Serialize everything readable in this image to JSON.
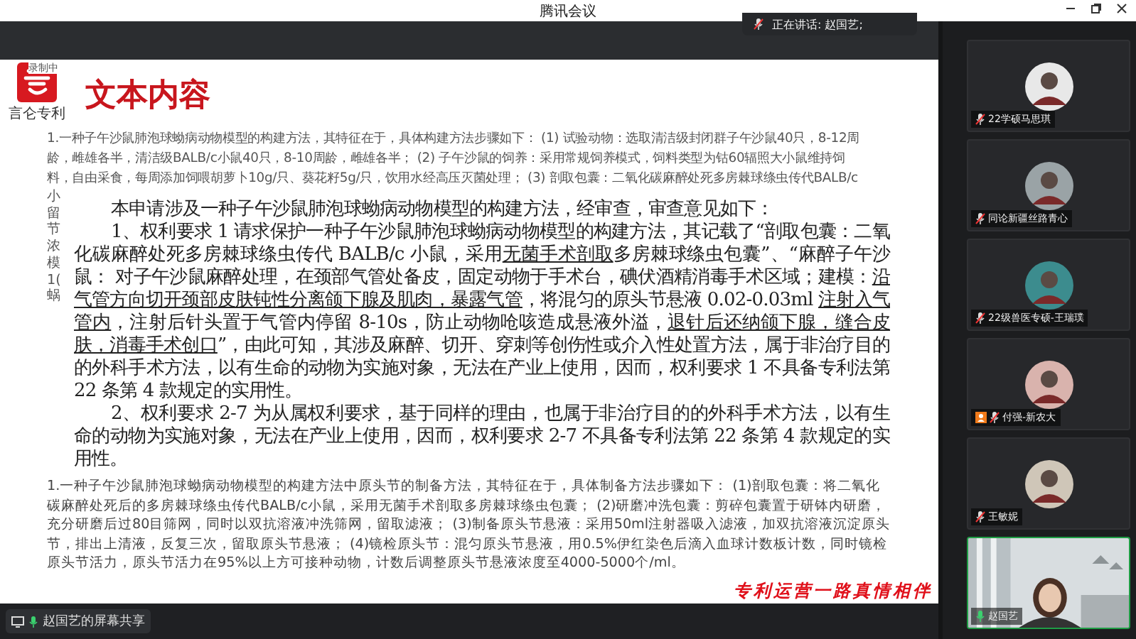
{
  "window": {
    "title": "腾讯会议"
  },
  "recording": {
    "label": "录制中"
  },
  "speaker_banner": {
    "label": "正在讲话: 赵国艺;"
  },
  "slide": {
    "brand": "言仑专利",
    "title": "文本内容",
    "paragraph_top_lines": [
      "1.一种子午沙鼠肺泡球蚴病动物模型的构建方法，其特征在于，具体构建方法步骤如下：  (1) 试验动物：选取清洁级封闭群子午沙鼠40只，8-12周",
      "龄，雌雄各半，清洁级BALB/c小鼠40只，8-10周龄，雌雄各半；  (2) 子午沙鼠的饲养：采用常规饲养模式，饲料类型为钴60辐照大小鼠维持饲",
      "料，自由采食，每周添加饲喂胡萝卜10g/只、葵花籽5g/只，饮用水经高压灭菌处理；  (3) 剖取包囊：二氧化碳麻醉处死多房棘球绦虫传代BALB/c"
    ],
    "line_starts": [
      "小",
      "留",
      "节",
      "浓",
      "模",
      "1(",
      "蜗"
    ],
    "document": {
      "heading": "本申请涉及一种子午沙鼠肺泡球蚴病动物模型的构建方法，经审查，审查意见如下：",
      "paragraphs": [
        {
          "segments": [
            {
              "text": "1、权利要求 1 请求保护一种子午沙鼠肺泡球蚴病动物模型的构建方法，其记载了“剖取包囊：二氧化碳麻醉处死多房棘球绦虫传代 BALB/c 小鼠，采用",
              "underlined": false
            },
            {
              "text": "无菌手术剖取",
              "underlined": true
            },
            {
              "text": "多房棘球绦虫包囊”、“麻醉子午沙鼠： 对子午沙鼠麻醉处理，在颈部气管处备皮，固定动物于手术台，碘伏酒精消毒手术区域；建模：",
              "underlined": false
            },
            {
              "text": "沿气管方向切开颈部皮肤钝性分离颌下腺及肌肉，暴露气管",
              "underlined": true
            },
            {
              "text": "，将混匀的原头节悬液 0.02-0.03ml ",
              "underlined": false
            },
            {
              "text": "注射入气管内",
              "underlined": true
            },
            {
              "text": "，注射后针头置于气管内停留 8-10s，防止动物呛咳造成悬液外溢，",
              "underlined": false
            },
            {
              "text": "退针后还纳颌下腺，缝合皮肤，消毒手术创口",
              "underlined": true
            },
            {
              "text": "”，由此可知，其涉及麻醉、切开、穿刺等创伤性或介入性处置方法，属于非治疗目的的外科手术方法，以有生命的动物为实施对象，无法在产业上使用，因而，权利要求 1 不具备专利法第 22 条第 4 款规定的实用性。",
              "underlined": false
            }
          ]
        },
        {
          "segments": [
            {
              "text": "2、权利要求 2-7 为从属权利要求，基于同样的理由，也属于非治疗目的的外科手术方法，以有生命的动物为实施对象，无法在产业上使用，因而，权利要求 2-7 不具备专利法第 22 条第 4 款规定的实用性。",
              "underlined": false
            }
          ]
        }
      ]
    },
    "paragraph_bottom": "1.一种子午沙鼠肺泡球蚴病动物模型的构建方法中原头节的制备方法，其特征在于，具体制备方法步骤如下： (1)剖取包囊：将二氧化碳麻醉处死后的多房棘球绦虫传代BALB/c小鼠，采用无菌手术剖取多房棘球绦虫包囊； (2)研磨冲洗包囊：剪碎包囊置于研钵内研磨，充分研磨后过80目筛网，同时以双抗溶液冲洗筛网，留取滤液； (3)制备原头节悬液：采用50ml注射器吸入滤液，加双抗溶液沉淀原头节，排出上清液，反复三次，留取原头节悬液； (4)镜检原头节：混匀原头节悬液，用0.5%伊红染色后滴入血球计数板计数，同时镜检原头节活力，原头节活力在95%以上方可接种动物，计数后调整原头节悬液浓度至4000-5000个/ml。",
    "slogan": "专利运营一路真情相伴"
  },
  "participants": [
    {
      "name": "22学硕马思琪",
      "kind": "avatar",
      "muted": true,
      "speaking": false,
      "host_badge": false
    },
    {
      "name": "同论新疆丝路青心",
      "kind": "avatar",
      "muted": true,
      "speaking": false,
      "host_badge": false
    },
    {
      "name": "22级兽医专硕-王瑞璞",
      "kind": "avatar",
      "muted": true,
      "speaking": false,
      "host_badge": false
    },
    {
      "name": "付强-新农大",
      "kind": "avatar",
      "muted": true,
      "speaking": false,
      "host_badge": true
    },
    {
      "name": "王敏妮",
      "kind": "avatar",
      "muted": true,
      "speaking": false,
      "host_badge": false
    },
    {
      "name": "赵国艺",
      "kind": "video",
      "muted": false,
      "speaking": true,
      "host_badge": false
    }
  ],
  "share_status": {
    "label": "赵国艺的屏幕共享"
  }
}
